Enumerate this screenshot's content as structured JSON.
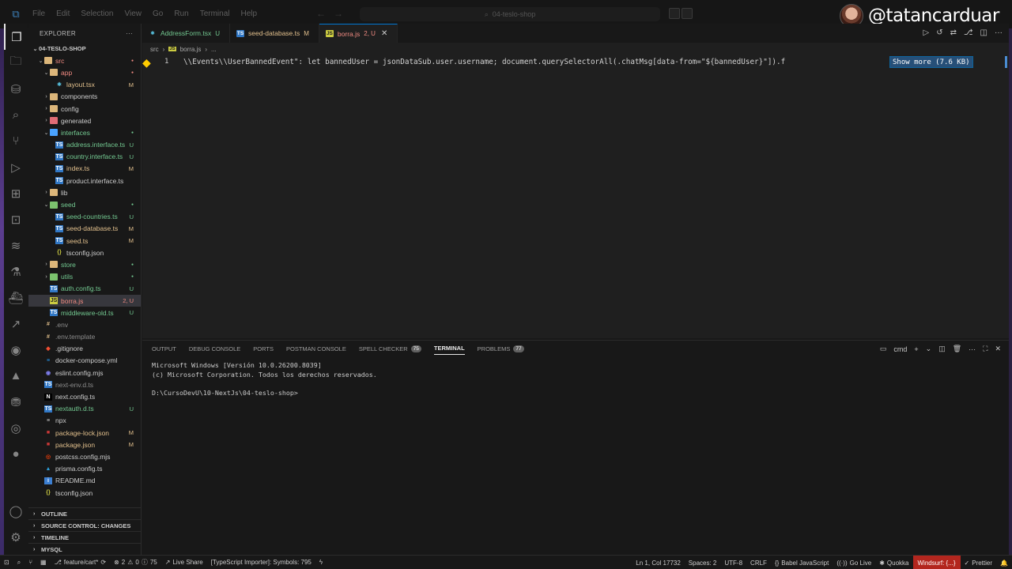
{
  "titlebar": {
    "menu": [
      "File",
      "Edit",
      "Selection",
      "View",
      "Go",
      "Run",
      "Terminal",
      "Help"
    ],
    "search_text": "04-teslo-shop",
    "watermark_handle": "@tatancarduar"
  },
  "activity": {
    "icons": [
      "explorer-icon",
      "files-icon",
      "database-icon",
      "search-icon",
      "source-control-icon",
      "run-debug-icon",
      "extensions-icon",
      "remote-icon",
      "windsurf-icon",
      "testing-icon",
      "docker-icon",
      "live-share-icon",
      "codeium-icon",
      "prisma-icon",
      "database-client-icon",
      "postman-icon",
      "github-icon"
    ],
    "bottom_icons": [
      "account-icon",
      "settings-gear-icon"
    ]
  },
  "explorer": {
    "header": "EXPLORER",
    "more": "···",
    "root": "04-TESLO-SHOP",
    "items": [
      {
        "label": "src",
        "type": "folder-open",
        "indent": 1,
        "badge": "",
        "color": "#f28b82",
        "dot": true
      },
      {
        "label": "app",
        "type": "folder-open",
        "indent": 2,
        "badge": "",
        "color": "#f28b82",
        "dot": true
      },
      {
        "label": "layout.tsx",
        "type": "file",
        "icon": "react",
        "indent": 3,
        "badge": "M",
        "color": "#e2c08d"
      },
      {
        "label": "components",
        "type": "folder",
        "indent": 2,
        "badge": "",
        "color": "#cccccc"
      },
      {
        "label": "config",
        "type": "folder",
        "indent": 2,
        "badge": "",
        "color": "#cccccc"
      },
      {
        "label": "generated",
        "type": "folder",
        "indent": 2,
        "badge": "",
        "color": "#cccccc",
        "folder_color": "#e06c75"
      },
      {
        "label": "interfaces",
        "type": "folder-open",
        "indent": 2,
        "badge": "",
        "color": "#73c991",
        "dot": true,
        "folder_color": "#4aa3ff"
      },
      {
        "label": "address.interface.ts",
        "type": "file",
        "icon": "ts",
        "indent": 3,
        "badge": "U",
        "color": "#73c991"
      },
      {
        "label": "country.interface.ts",
        "type": "file",
        "icon": "ts",
        "indent": 3,
        "badge": "U",
        "color": "#73c991"
      },
      {
        "label": "index.ts",
        "type": "file",
        "icon": "ts",
        "indent": 3,
        "badge": "M",
        "color": "#e2c08d"
      },
      {
        "label": "product.interface.ts",
        "type": "file",
        "icon": "ts",
        "indent": 3,
        "badge": "",
        "color": "#cccccc"
      },
      {
        "label": "lib",
        "type": "folder",
        "indent": 2,
        "badge": "",
        "color": "#cccccc"
      },
      {
        "label": "seed",
        "type": "folder-open",
        "indent": 2,
        "badge": "",
        "color": "#73c991",
        "dot": true,
        "folder_color": "#7cc36e"
      },
      {
        "label": "seed-countries.ts",
        "type": "file",
        "icon": "ts",
        "indent": 3,
        "badge": "U",
        "color": "#73c991"
      },
      {
        "label": "seed-database.ts",
        "type": "file",
        "icon": "ts",
        "indent": 3,
        "badge": "M",
        "color": "#e2c08d"
      },
      {
        "label": "seed.ts",
        "type": "file",
        "icon": "ts",
        "indent": 3,
        "badge": "M",
        "color": "#e2c08d"
      },
      {
        "label": "tsconfig.json",
        "type": "file",
        "icon": "json",
        "indent": 3,
        "badge": "",
        "color": "#cccccc"
      },
      {
        "label": "store",
        "type": "folder",
        "indent": 2,
        "badge": "",
        "color": "#73c991",
        "dot": true
      },
      {
        "label": "utils",
        "type": "folder",
        "indent": 2,
        "badge": "",
        "color": "#73c991",
        "dot": true,
        "folder_color": "#7cc36e"
      },
      {
        "label": "auth.config.ts",
        "type": "file",
        "icon": "ts",
        "indent": 2,
        "badge": "U",
        "color": "#73c991"
      },
      {
        "label": "borra.js",
        "type": "file",
        "icon": "js",
        "indent": 2,
        "badge": "2, U",
        "color": "#f28b82",
        "selected": true
      },
      {
        "label": "middleware-old.ts",
        "type": "file",
        "icon": "ts",
        "indent": 2,
        "badge": "U",
        "color": "#73c991"
      },
      {
        "label": ".env",
        "type": "file",
        "icon": "env",
        "indent": 1,
        "badge": "",
        "color": "#8c8c8c"
      },
      {
        "label": ".env.template",
        "type": "file",
        "icon": "env",
        "indent": 1,
        "badge": "",
        "color": "#8c8c8c"
      },
      {
        "label": ".gitignore",
        "type": "file",
        "icon": "git",
        "indent": 1,
        "badge": "",
        "color": "#cccccc"
      },
      {
        "label": "docker-compose.yml",
        "type": "file",
        "icon": "docker",
        "indent": 1,
        "badge": "",
        "color": "#cccccc"
      },
      {
        "label": "eslint.config.mjs",
        "type": "file",
        "icon": "eslint",
        "indent": 1,
        "badge": "",
        "color": "#cccccc"
      },
      {
        "label": "next-env.d.ts",
        "type": "file",
        "icon": "ts",
        "indent": 1,
        "badge": "",
        "color": "#8c8c8c"
      },
      {
        "label": "next.config.ts",
        "type": "file",
        "icon": "next",
        "indent": 1,
        "badge": "",
        "color": "#cccccc"
      },
      {
        "label": "nextauth.d.ts",
        "type": "file",
        "icon": "ts",
        "indent": 1,
        "badge": "U",
        "color": "#73c991"
      },
      {
        "label": "npx",
        "type": "file",
        "icon": "plain",
        "indent": 1,
        "badge": "",
        "color": "#cccccc"
      },
      {
        "label": "package-lock.json",
        "type": "file",
        "icon": "npm",
        "indent": 1,
        "badge": "M",
        "color": "#e2c08d"
      },
      {
        "label": "package.json",
        "type": "file",
        "icon": "npm",
        "indent": 1,
        "badge": "M",
        "color": "#e2c08d"
      },
      {
        "label": "postcss.config.mjs",
        "type": "file",
        "icon": "postcss",
        "indent": 1,
        "badge": "",
        "color": "#cccccc"
      },
      {
        "label": "prisma.config.ts",
        "type": "file",
        "icon": "prisma",
        "indent": 1,
        "badge": "",
        "color": "#cccccc"
      },
      {
        "label": "README.md",
        "type": "file",
        "icon": "info",
        "indent": 1,
        "badge": "",
        "color": "#cccccc"
      },
      {
        "label": "tsconfig.json",
        "type": "file",
        "icon": "json",
        "indent": 1,
        "badge": "",
        "color": "#cccccc"
      }
    ],
    "sections": [
      "OUTLINE",
      "SOURCE CONTROL: CHANGES",
      "TIMELINE",
      "MYSQL"
    ]
  },
  "tabs": [
    {
      "label": "AddressForm.tsx",
      "status": "U",
      "icon": "react",
      "status_color": "#73c991",
      "active": false
    },
    {
      "label": "seed-database.ts",
      "status": "M",
      "icon": "ts",
      "status_color": "#e2c08d",
      "active": false
    },
    {
      "label": "borra.js",
      "status": "2, U",
      "icon": "js",
      "status_color": "#f28b82",
      "active": true
    }
  ],
  "breadcrumb": {
    "root": "src",
    "file": "borra.js",
    "more": "..."
  },
  "editor": {
    "line_number": "1",
    "code": "⁠\\\\Events\\\\UserBannedEvent\": let bannedUser = jsonDataSub.user.username; document.querySelectorAll(.chatMsg[data-from=\"${bannedUser}\"]).f",
    "show_more": "Show more (7.6 KB)"
  },
  "panel": {
    "tabs": [
      {
        "label": "OUTPUT",
        "badge": ""
      },
      {
        "label": "DEBUG CONSOLE",
        "badge": ""
      },
      {
        "label": "PORTS",
        "badge": ""
      },
      {
        "label": "POSTMAN CONSOLE",
        "badge": ""
      },
      {
        "label": "SPELL CHECKER",
        "badge": "75"
      },
      {
        "label": "TERMINAL",
        "badge": "",
        "active": true
      },
      {
        "label": "PROBLEMS",
        "badge": "77"
      }
    ],
    "shell": "cmd",
    "terminal_lines": [
      "Microsoft Windows [Versión 10.0.26200.8039]",
      "(c) Microsoft Corporation. Todos los derechos reservados.",
      "",
      "D:\\CursoDevU\\10-NextJs\\04-teslo-shop>"
    ]
  },
  "statusbar": {
    "branch": "feature/cart*",
    "errors": "2",
    "warnings": "0",
    "info": "75",
    "live_share": "Live Share",
    "importer": "[TypeScript Importer]: Symbols: 795",
    "position": "Ln 1, Col 17732",
    "spaces": "Spaces: 2",
    "encoding": "UTF-8",
    "eol": "CRLF",
    "language": "Babel JavaScript",
    "go_live": "Go Live",
    "quokka": "Quokka",
    "windsurf": "Windsurf: {...}",
    "prettier": "Prettier"
  }
}
